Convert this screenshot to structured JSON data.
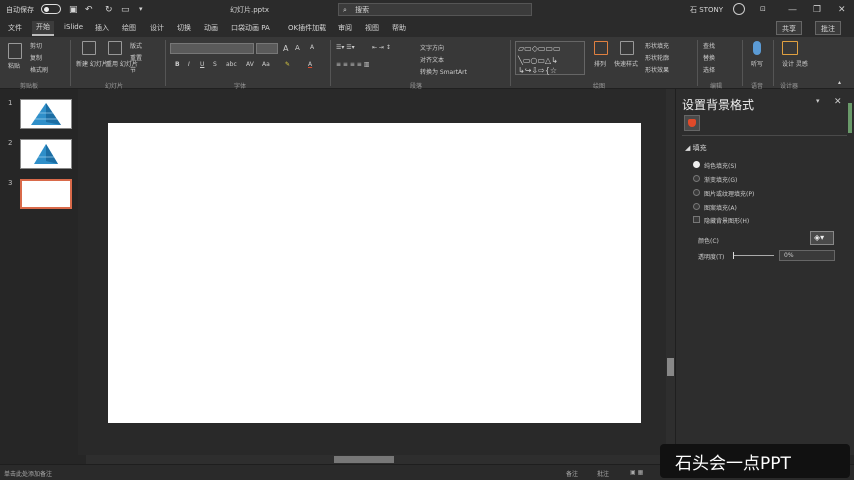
{
  "titlebar": {
    "autosave": "自动保存",
    "filename": "幻灯片.pptx",
    "search_placeholder": "搜索",
    "user": "石 STONY",
    "user_initial": "石"
  },
  "tabs": [
    "文件",
    "开始",
    "iSlide",
    "插入",
    "绘图",
    "设计",
    "切换",
    "动画",
    "口袋动画 PA",
    "OK插件加载",
    "审阅",
    "视图",
    "帮助"
  ],
  "share_label": "共享",
  "comment_label": "批注",
  "ribbon": {
    "clipboard": {
      "paste": "粘贴",
      "cut": "剪切",
      "copy": "复制",
      "format_painter": "格式刷",
      "label": "剪贴板"
    },
    "slides": {
      "new_slide": "新建\n幻灯片",
      "reuse": "重用\n幻灯片",
      "layout": "版式",
      "reset": "重置",
      "section": "节",
      "label": "幻灯片"
    },
    "font": {
      "label": "字体"
    },
    "paragraph": {
      "text_direction": "文字方向",
      "align_text": "对齐文本",
      "smartart": "转换为 SmartArt",
      "label": "段落"
    },
    "drawing": {
      "arrange": "排列",
      "quick_styles": "快速样式",
      "shape_fill": "形状填充",
      "shape_outline": "形状轮廓",
      "shape_effects": "形状效果",
      "label": "绘图"
    },
    "editing": {
      "find": "查找",
      "replace": "替换",
      "select": "选择",
      "label": "编辑"
    },
    "voice": {
      "dictate": "听写",
      "label": "语音"
    },
    "designer": {
      "design_ideas": "设计\n灵感",
      "label": "设计器"
    }
  },
  "slides": [
    {
      "number": "1",
      "type": "pyramid"
    },
    {
      "number": "2",
      "type": "pyramid"
    },
    {
      "number": "3",
      "type": "blank",
      "selected": true
    }
  ],
  "pane": {
    "title": "设置背景格式",
    "section": "填充",
    "options": [
      {
        "label": "纯色填充(S)",
        "selected": true
      },
      {
        "label": "渐变填充(G)",
        "selected": false
      },
      {
        "label": "图片或纹理填充(P)",
        "selected": false
      },
      {
        "label": "图案填充(A)",
        "selected": false
      }
    ],
    "hide_bg": "隐藏背景图形(H)",
    "color_label": "颜色(C)",
    "transparency_label": "透明度(T)",
    "transparency_value": "0%"
  },
  "statusbar": {
    "left": "单击此处添加备注",
    "notes": "备注",
    "comments": "批注"
  },
  "watermark": "石头会一点PPT",
  "colors": {
    "accent": "#d96a4a",
    "pyramid": "#2f8fc9"
  }
}
